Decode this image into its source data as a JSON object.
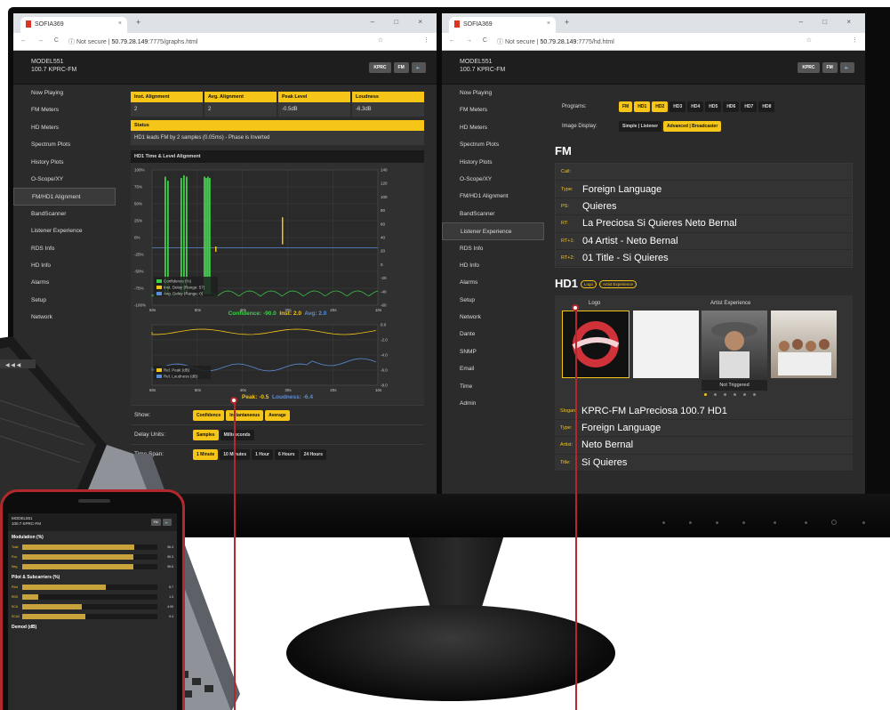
{
  "colors": {
    "accent": "#f5c518",
    "bg": "#2b2b2b",
    "fm_line": "#f5c518",
    "hd_line": "#5b8dd6",
    "confidence": "#3ecf4a",
    "callout": "#b3282d"
  },
  "browser": {
    "left": {
      "tab_title": "SOFIA369",
      "url_prefix": "Not secure",
      "url_host": "50.79.28.149",
      "url_path": ":7775/graphs.html"
    },
    "right": {
      "tab_title": "SOFIA369",
      "url_prefix": "Not secure",
      "url_host": "50.79.28.149",
      "url_path": ":7775/hd.html"
    }
  },
  "header": {
    "model": "MODEL551",
    "station": "100.7 KPRC-FM",
    "buttons": [
      "KPRC",
      "FM",
      "🔈"
    ]
  },
  "sidebar_left": [
    "Now Playing",
    "FM Meters",
    "HD Meters",
    "Spectrum Plots",
    "History Plots",
    "O-Scope/XY",
    "FM/HD1 Alignment",
    "BandScanner",
    "Listener Experience",
    "RDS Info",
    "HD Info",
    "Alarms",
    "Setup",
    "Network"
  ],
  "sidebar_right": [
    "Now Playing",
    "FM Meters",
    "HD Meters",
    "Spectrum Plots",
    "History Plots",
    "O-Scope/XY",
    "FM/HD1 Alignment",
    "BandScanner",
    "Listener Experience",
    "RDS Info",
    "HD Info",
    "Alarms",
    "Setup",
    "Network",
    "Dante",
    "SNMP",
    "Email",
    "Time",
    "Admin"
  ],
  "alignment": {
    "metrics": [
      {
        "label": "Inst. Alignment",
        "value": "2"
      },
      {
        "label": "Avg. Alignment",
        "value": "2"
      },
      {
        "label": "Peak Level",
        "value": "-0.5dB"
      },
      {
        "label": "Loudness",
        "value": "-6.3dB"
      }
    ],
    "status_label": "Status",
    "status_text": "HD1 leads FM by 2 samples (0.05ms) - Phase is Inverted",
    "graph_title": "HD1 Time & Level Alignment",
    "chart_top": {
      "y_left": [
        "100%",
        "75%",
        "50%",
        "25%",
        "0%",
        "-25%",
        "-50%",
        "-75%",
        "-100%"
      ],
      "y_right": [
        "140",
        "120",
        "100",
        "80",
        "60",
        "40",
        "20",
        "0",
        "-20",
        "-40",
        "-60"
      ],
      "x": [
        "60s",
        "50s",
        "40s",
        "30s",
        "20s",
        "10s"
      ],
      "legend": [
        "Confidence (%)",
        "Inst. Delay (Range: 57)",
        "Avg. Delay (Range: 0)"
      ]
    },
    "readout_top": {
      "confidence_label": "Confidence:",
      "confidence": "-90.0",
      "inst_label": "Inst:",
      "inst": "2.0",
      "avg_label": "Avg:",
      "avg": "2.0"
    },
    "chart_bottom": {
      "y_right": [
        "0.0",
        "-2.0",
        "-4.0",
        "-6.0",
        "-8.0"
      ],
      "x": [
        "60s",
        "50s",
        "40s",
        "30s",
        "20s",
        "10s"
      ],
      "legend": [
        "Rel. Peak (dB)",
        "Rel. Loudness (dB)"
      ]
    },
    "readout_bottom": {
      "peak_label": "Peak:",
      "peak": "-0.5",
      "loud_label": "Loudness:",
      "loud": "-6.4"
    },
    "show": {
      "label": "Show:",
      "options": [
        "Confidence",
        "Instantaneous",
        "Average"
      ]
    },
    "delay": {
      "label": "Delay Units:",
      "options": [
        "Samples",
        "Milliseconds"
      ]
    },
    "timespan": {
      "label": "Time Span:",
      "options": [
        "1 Minute",
        "10 Minutes",
        "1 Hour",
        "6 Hours",
        "24 Hours"
      ]
    }
  },
  "hdinfo": {
    "programs_label": "Programs:",
    "programs": [
      "FM",
      "HD1",
      "HD2",
      "HD3",
      "HD4",
      "HD5",
      "HD6",
      "HD7",
      "HD8"
    ],
    "image_label": "Image Display:",
    "image_options": [
      "Simple | Listener",
      "Advanced | Broadcaster"
    ],
    "fm_title": "FM",
    "rds": [
      {
        "k": "Call:",
        "v": ""
      },
      {
        "k": "Type:",
        "v": "Foreign Language"
      },
      {
        "k": "PS:",
        "v": "Quieres"
      },
      {
        "k": "RT:",
        "v": "La Preciosa Si Quieres Neto Bernal"
      },
      {
        "k": "RT+1:",
        "v": "04 Artist - Neto Bernal"
      },
      {
        "k": "RT+2:",
        "v": "01 Title - Si Quieres"
      }
    ],
    "hd1_title": "HD1",
    "hd1_tags": [
      "Logo",
      "Artist Experience"
    ],
    "logo_caption": "Logo",
    "artist_caption": "Artist Experience",
    "not_triggered": "Not Triggered",
    "hd1_fields": [
      {
        "k": "Slogan:",
        "v": "KPRC-FM LaPreciosa 100.7 HD1"
      },
      {
        "k": "Type:",
        "v": "Foreign Language"
      },
      {
        "k": "Artist:",
        "v": "Neto Bernal"
      },
      {
        "k": "Title:",
        "v": "Si Quieres"
      }
    ]
  },
  "phone": {
    "modulation_label": "Modulation (%)",
    "meters": [
      {
        "k": "Total",
        "v": "96.4",
        "f": 0.83
      },
      {
        "k": "Pos",
        "v": "95.3",
        "f": 0.82
      },
      {
        "k": "Neg",
        "v": "95.6",
        "f": 0.82
      }
    ],
    "pilot_label": "Pilot & Subcarriers (%)",
    "pilot": [
      {
        "k": "Pilot",
        "v": "8.7",
        "f": 0.62
      },
      {
        "k": "RDS",
        "v": "1.3",
        "f": 0.12
      },
      {
        "k": "SCA",
        "v": "4.99",
        "f": 0.44
      },
      {
        "k": "SCA2",
        "v": "5.4",
        "f": 0.47
      }
    ],
    "demod_label": "Demod (dB)"
  }
}
